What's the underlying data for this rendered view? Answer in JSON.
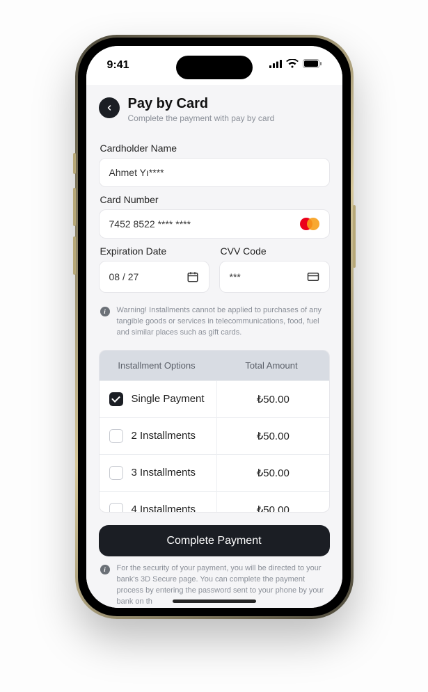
{
  "status": {
    "time": "9:41"
  },
  "header": {
    "title": "Pay by Card",
    "subtitle": "Complete the payment with pay by card"
  },
  "fields": {
    "name_label": "Cardholder Name",
    "name_value": "Ahmet Yı****",
    "card_label": "Card Number",
    "card_value": "7452 8522 **** ****",
    "card_brand": "mastercard",
    "exp_label": "Expiration Date",
    "exp_value": "08 / 27",
    "cvv_label": "CVV Code",
    "cvv_value": "***"
  },
  "warning": "Warning! Installments cannot be applied to purchases of any tangible goods or services in telecommunications, food, fuel and similar places such as gift cards.",
  "table": {
    "head_option": "Installment Options",
    "head_amount": "Total Amount",
    "rows": [
      {
        "label": "Single Payment",
        "amount": "₺50.00",
        "checked": true
      },
      {
        "label": "2 Installments",
        "amount": "₺50.00",
        "checked": false
      },
      {
        "label": "3 Installments",
        "amount": "₺50.00",
        "checked": false
      },
      {
        "label": "4 Installments",
        "amount": "₺50.00",
        "checked": false
      }
    ]
  },
  "cta": "Complete Payment",
  "footer": "For the security of your payment, you will be directed to your bank's 3D Secure page. You can complete the payment process by entering the password sent to your phone by your bank on th"
}
